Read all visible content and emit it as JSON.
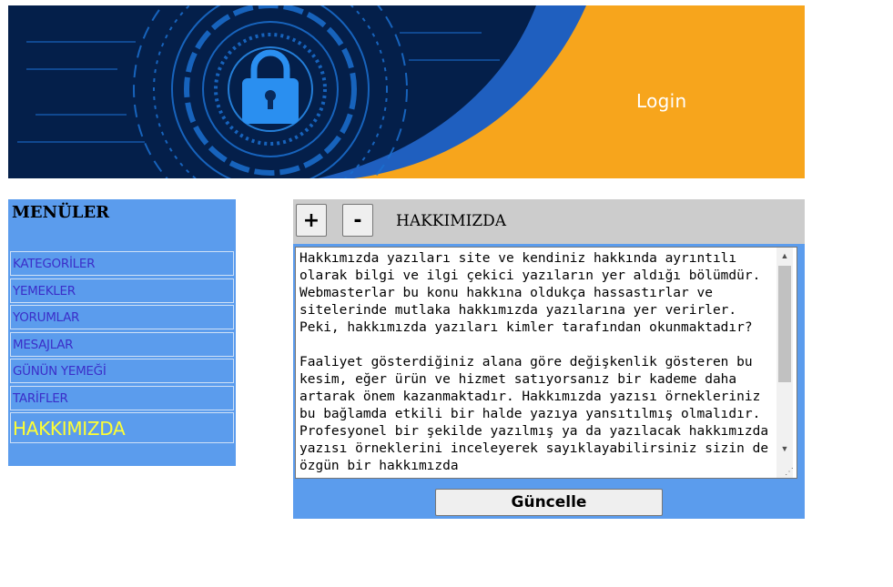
{
  "banner": {
    "login_label": "Login",
    "illustration": "padlock-cyber-security-icon",
    "colors": {
      "dark_blue": "#041f4a",
      "bright_blue": "#1f7fd6",
      "orange": "#f7a51c"
    }
  },
  "sidebar": {
    "title": "MENÜLER",
    "items": [
      {
        "label": "KATEGORİLER"
      },
      {
        "label": "YEMEKLER"
      },
      {
        "label": "YORUMLAR"
      },
      {
        "label": "MESAJLAR"
      },
      {
        "label": "GÜNÜN YEMEĞİ"
      },
      {
        "label": "TARİFLER"
      },
      {
        "label": "HAKKIMIZDA"
      }
    ],
    "active_item": "HAKKIMIZDA",
    "background_color": "#5b9ced",
    "link_color": "#3b2fc9",
    "active_color": "#ffff33"
  },
  "panel": {
    "plus_label": "+",
    "minus_label": "-",
    "title": "HAKKIMIZDA",
    "content": "Hakkımızda yazıları site ve kendiniz hakkında ayrıntılı olarak bilgi ve ilgi çekici yazıların yer aldığı bölümdür. Webmasterlar bu konu hakkına oldukça hassastırlar ve sitelerinde mutlaka hakkımızda yazılarına yer verirler. Peki, hakkımızda yazıları kimler tarafından okunmaktadır?\n\nFaaliyet gösterdiğiniz alana göre değişkenlik gösteren bu kesim, eğer ürün ve hizmet satıyorsanız bir kademe daha artarak önem kazanmaktadır. Hakkımızda yazısı örnekleriniz bu bağlamda etkili bir halde yazıya yansıtılmış olmalıdır.  Profesyonel bir şekilde yazılmış ya da yazılacak hakkımızda yazısı örneklerini inceleyerek sayıklayabilirsiniz sizin de özgün bir hakkımızda",
    "update_label": "Güncelle"
  }
}
